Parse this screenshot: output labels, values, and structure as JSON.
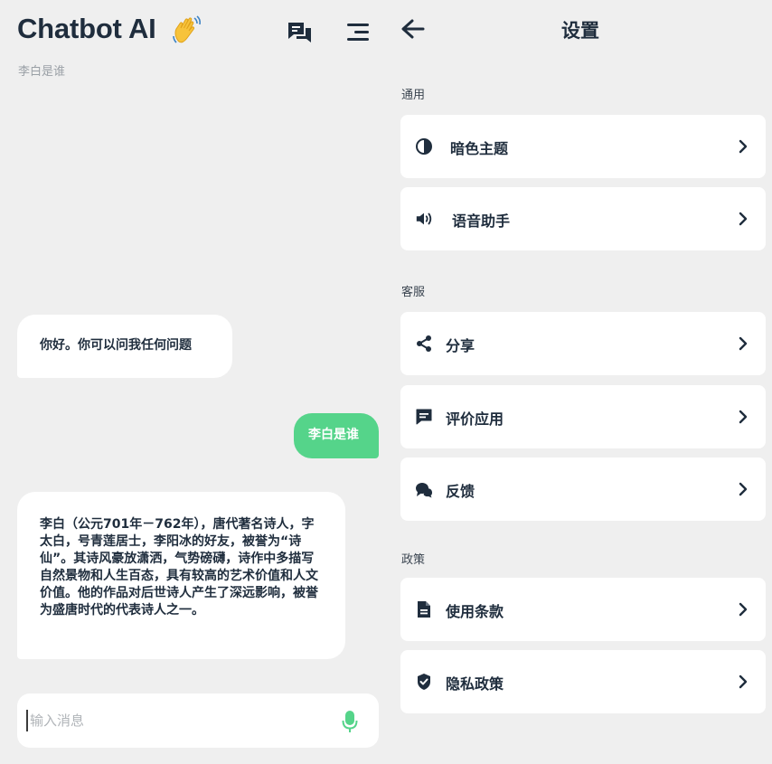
{
  "chat": {
    "title": "Chatbot AI",
    "subtitle": "李白是谁",
    "messages": [
      {
        "role": "bot",
        "text": "你好。你可以问我任何问题"
      },
      {
        "role": "user",
        "text": "李白是谁"
      },
      {
        "role": "bot",
        "text": "李白（公元701年－762年），唐代著名诗人，字太白，号青莲居士，李阳冰的好友，被誉为“诗仙”。其诗风豪放潇洒，气势磅礴，诗作中多描写自然景物和人生百态，具有较高的艺术价值和人文价值。他的作品对后世诗人产生了深远影响，被誉为盛唐时代的代表诗人之一。"
      }
    ],
    "input_placeholder": "输入消息",
    "icons": {
      "wave": "waving-hand-icon",
      "new_chat": "chat-bubbles-icon",
      "menu": "menu-icon",
      "mic": "microphone-icon"
    },
    "colors": {
      "user_bubble": "#55d48a",
      "bot_bubble": "#ffffff",
      "mic": "#55d48a"
    }
  },
  "settings": {
    "title": "设置",
    "back_icon": "arrow-left-icon",
    "sections": [
      {
        "label": "通用",
        "items": [
          {
            "label": "暗色主题",
            "icon": "contrast-icon"
          },
          {
            "label": "语音助手",
            "icon": "speaker-icon"
          }
        ]
      },
      {
        "label": "客服",
        "items": [
          {
            "label": "分享",
            "icon": "share-icon"
          },
          {
            "label": "评价应用",
            "icon": "review-icon"
          },
          {
            "label": "反馈",
            "icon": "feedback-icon"
          }
        ]
      },
      {
        "label": "政策",
        "items": [
          {
            "label": "使用条款",
            "icon": "document-icon"
          },
          {
            "label": "隐私政策",
            "icon": "shield-check-icon"
          }
        ]
      }
    ]
  }
}
